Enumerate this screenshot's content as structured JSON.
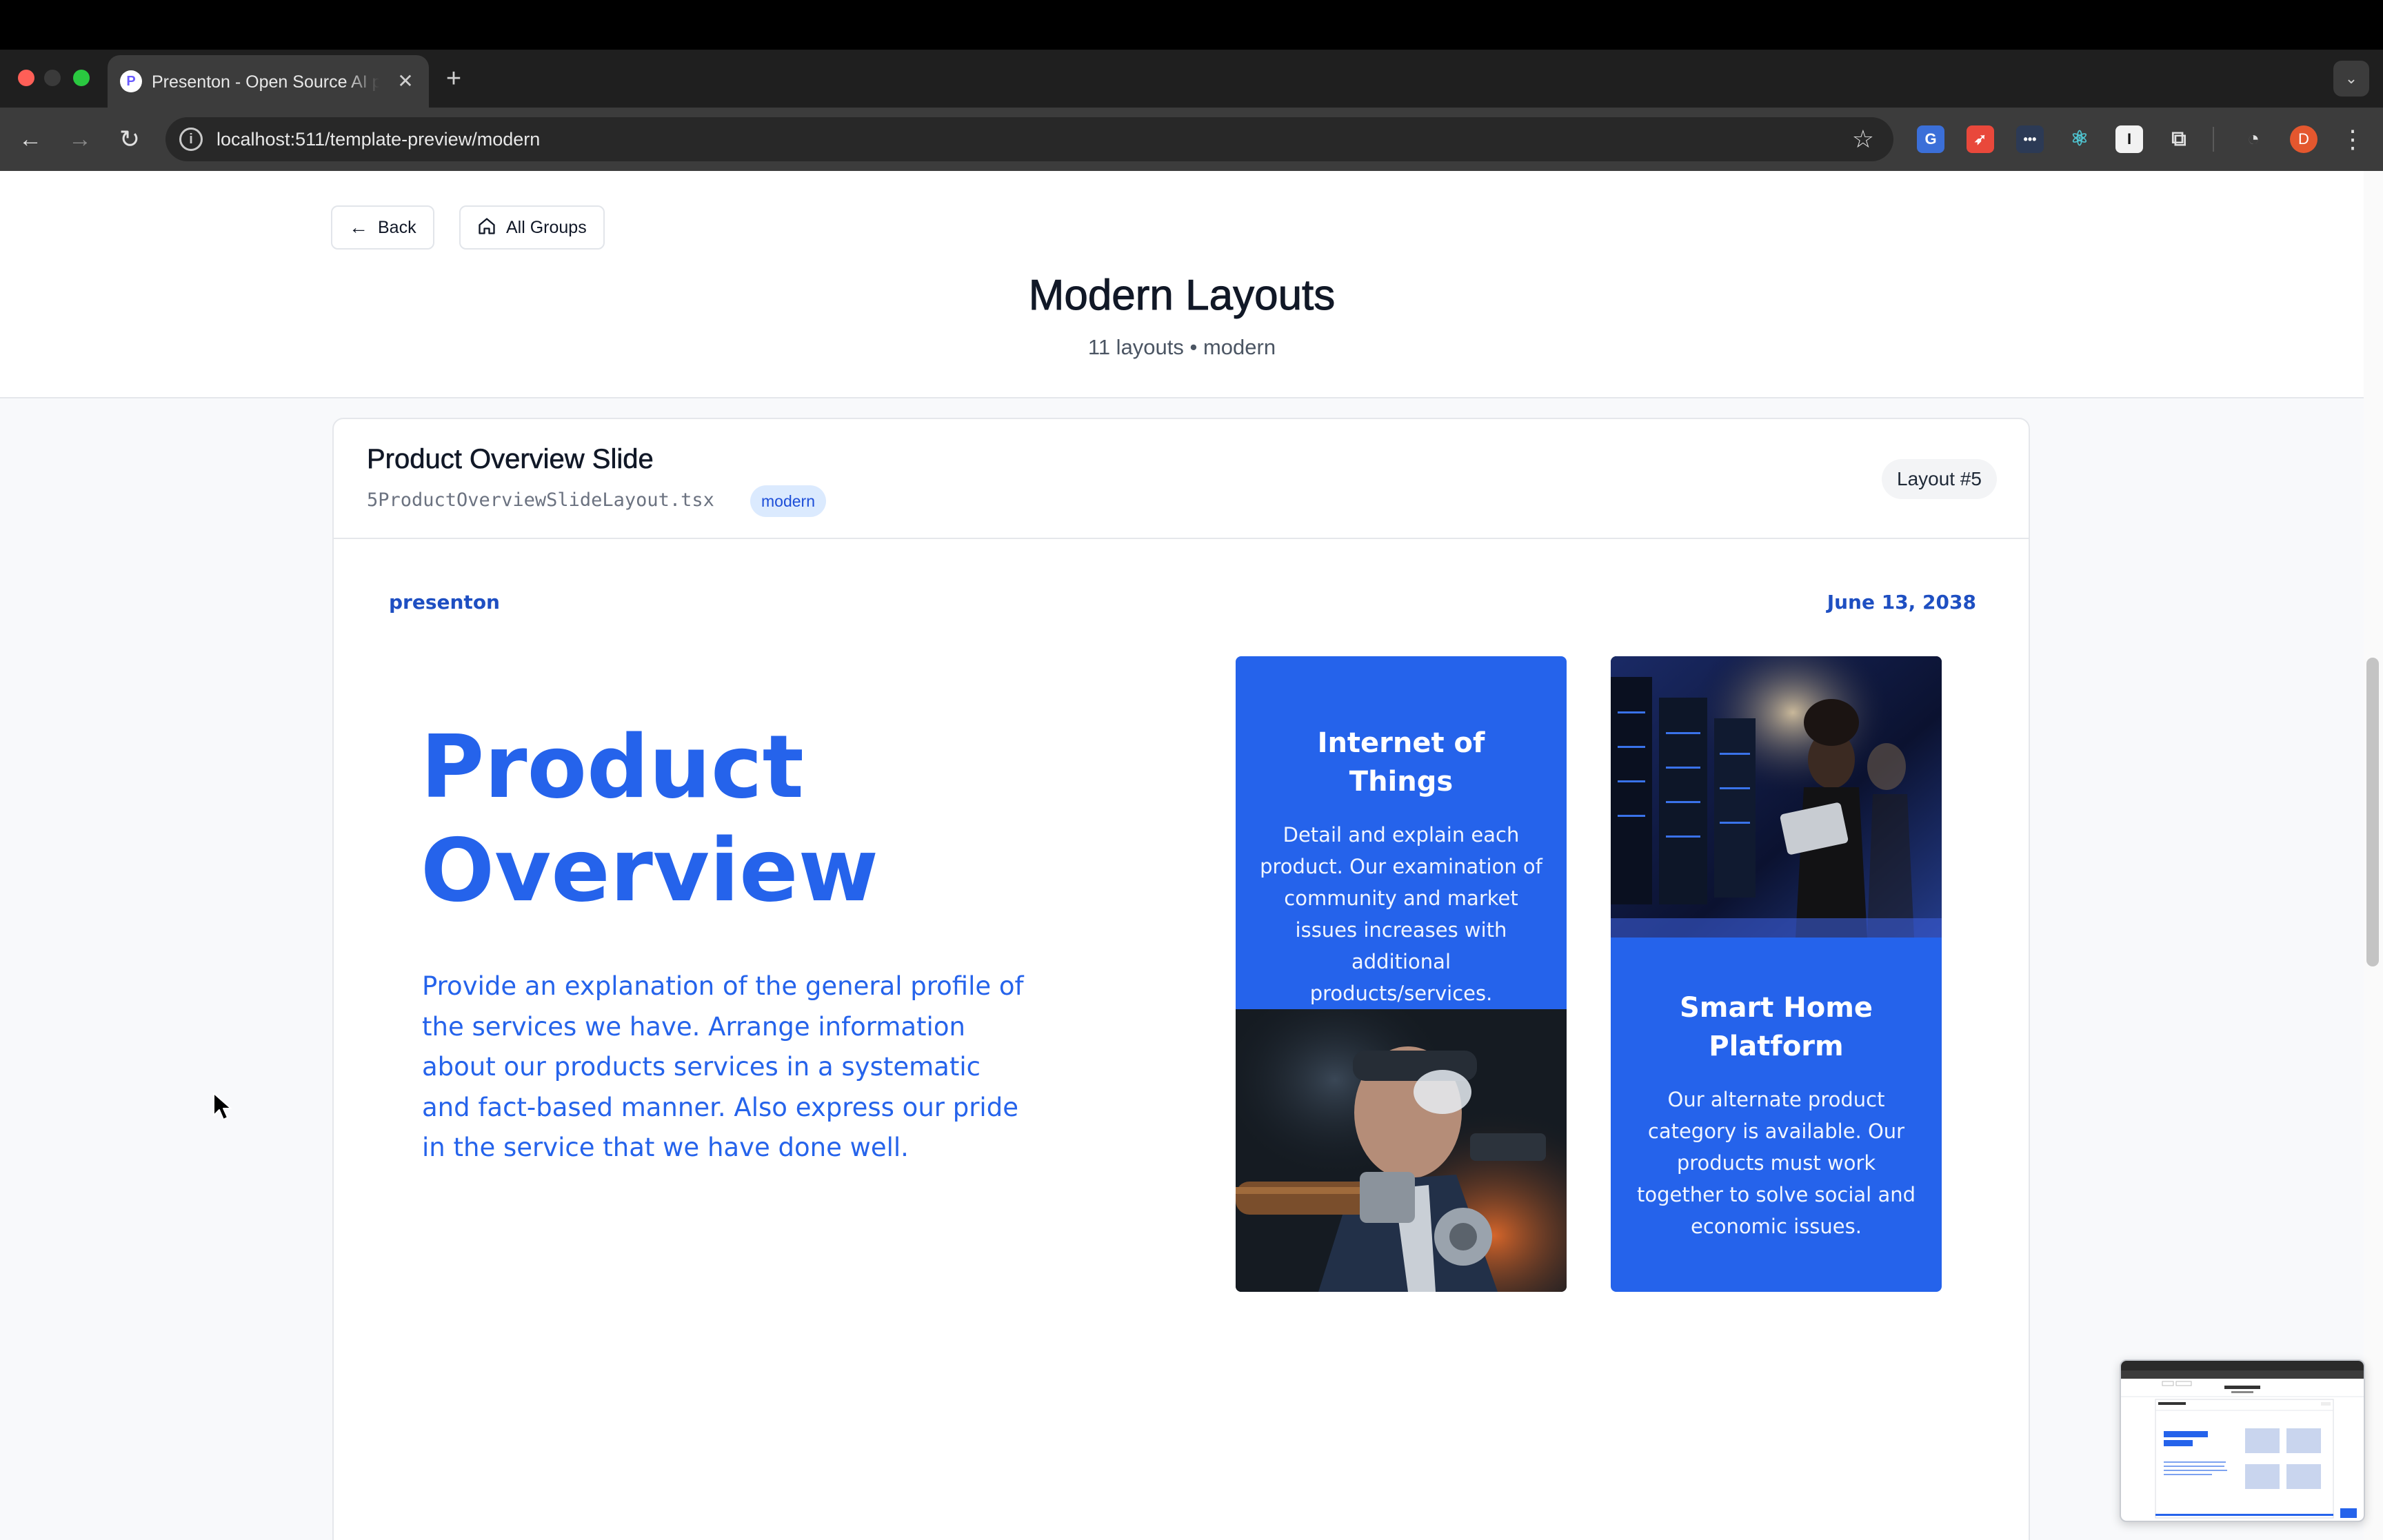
{
  "browser": {
    "tab_title": "Presenton - Open Source AI presentation generator",
    "tab_favicon": "P",
    "url": "localhost:511/template-preview/modern",
    "avatar_initial": "D",
    "icons": [
      "back-arrow-icon",
      "forward-arrow-icon",
      "reload-icon",
      "site-info-icon",
      "bookmark-star-icon",
      "extensions-icon",
      "menu-kebab-icon"
    ]
  },
  "header": {
    "back_label": "Back",
    "all_groups_label": "All Groups",
    "title": "Modern Layouts",
    "subtitle": "11 layouts • modern"
  },
  "card": {
    "title": "Product Overview Slide",
    "file_name": "5ProductOverviewSlideLayout.tsx",
    "tag": "modern",
    "layout_badge": "Layout #5"
  },
  "slide": {
    "brand": "presenton",
    "date": "June 13, 2038",
    "title_line1": "Product",
    "title_line2": "Overview",
    "description": "Provide an explanation of the general profile of the services we have. Arrange information about our products services in a systematic and fact-based manner. Also express our pride in the service that we have done well.",
    "products": [
      {
        "title": "Internet of Things",
        "text": "Detail and explain each product. Our examination of community and market issues increases with additional products/services."
      },
      {
        "title": "Smart Home Platform",
        "text": "Our alternate product category is available. Our products must work together to solve social and economic issues."
      }
    ],
    "accent_color": "#2563eb"
  }
}
